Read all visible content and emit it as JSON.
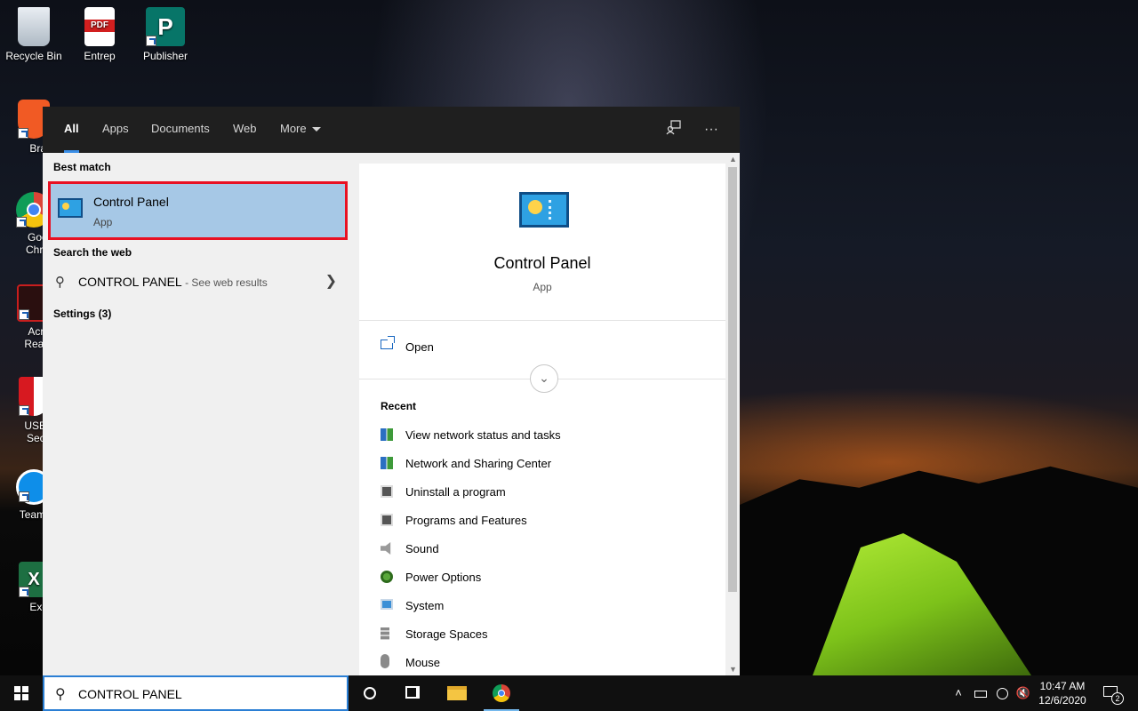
{
  "desktop": {
    "icons": [
      {
        "label": "Recycle Bin"
      },
      {
        "label": "Entrep"
      },
      {
        "label": "Publisher"
      },
      {
        "label": "Brave"
      },
      {
        "label": "Googl",
        "label2": "Chrom"
      },
      {
        "label": "Acrob",
        "label2": "Reader"
      },
      {
        "label": "USB Di",
        "label2": "Securi"
      },
      {
        "label": "TeamVie"
      },
      {
        "label": "Excel"
      }
    ],
    "pdf_badge": "PDF",
    "publisher_letter": "P",
    "excel_letter": "X"
  },
  "search_panel": {
    "tabs": [
      {
        "label": "All",
        "active": true
      },
      {
        "label": "Apps"
      },
      {
        "label": "Documents"
      },
      {
        "label": "Web"
      },
      {
        "label": "More"
      }
    ],
    "feedback_icon": "feedback-icon",
    "more_options_label": "···",
    "best_match_heading": "Best match",
    "best_match": {
      "title": "Control Panel",
      "subtitle": "App"
    },
    "search_web_heading": "Search the web",
    "web_result": {
      "query": "CONTROL PANEL",
      "suffix": "- See web results"
    },
    "settings_heading": "Settings (3)",
    "preview": {
      "title": "Control Panel",
      "subtitle": "App",
      "open_label": "Open",
      "recent_heading": "Recent",
      "recent": [
        {
          "label": "View network status and tasks",
          "icon": "network-icon"
        },
        {
          "label": "Network and Sharing Center",
          "icon": "network-icon"
        },
        {
          "label": "Uninstall a program",
          "icon": "programs-icon"
        },
        {
          "label": "Programs and Features",
          "icon": "programs-icon"
        },
        {
          "label": "Sound",
          "icon": "speaker-icon"
        },
        {
          "label": "Power Options",
          "icon": "power-icon"
        },
        {
          "label": "System",
          "icon": "system-icon"
        },
        {
          "label": "Storage Spaces",
          "icon": "storage-icon"
        },
        {
          "label": "Mouse",
          "icon": "mouse-icon"
        }
      ]
    }
  },
  "taskbar": {
    "search_value": "CONTROL PANEL",
    "clock_time": "10:47 AM",
    "clock_date": "12/6/2020",
    "notification_count": "2"
  },
  "colors": {
    "highlight_border": "#e81123",
    "selection_bg": "#a6c8e6",
    "accent": "#3a8ee6"
  }
}
